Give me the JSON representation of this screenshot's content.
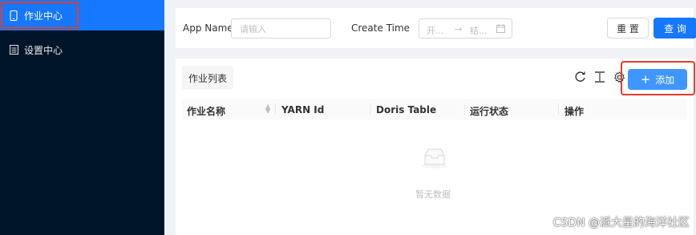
{
  "sidebar": {
    "items": [
      {
        "label": "作业中心",
        "icon": "mobile-icon",
        "active": true
      },
      {
        "label": "设置中心",
        "icon": "document-icon",
        "active": false
      }
    ]
  },
  "search": {
    "app_name_label": "App Name",
    "app_name_placeholder": "请输入",
    "create_time_label": "Create Time",
    "start_placeholder": "开...",
    "end_placeholder": "结...",
    "reset_label": "重 置",
    "query_label": "查 询"
  },
  "list": {
    "title": "作业列表",
    "add_label": "添加",
    "columns": [
      "作业名称",
      "YARN Id",
      "Doris Table",
      "运行状态",
      "操作"
    ],
    "empty_text": "暂无数据"
  },
  "watermark": "CSDN @派大星的海洋社区",
  "colors": {
    "primary": "#1677ff",
    "sidebar": "#001529",
    "highlight": "#e03c2e"
  }
}
